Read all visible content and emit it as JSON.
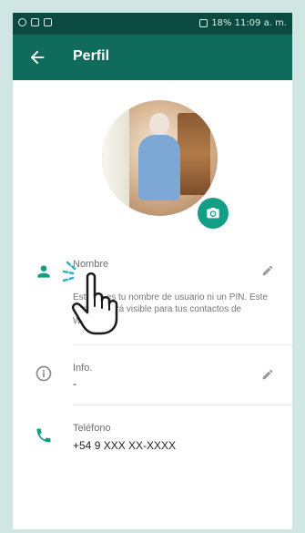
{
  "statusbar": {
    "right_text": "18% 11:09 a. m."
  },
  "appbar": {
    "title": "Perfil"
  },
  "profile": {
    "name": {
      "label": "Nombre",
      "hint": "Este no es tu nombre de usuario ni un PIN. Este nombre será visible para tus contactos de WhatsApp."
    },
    "info": {
      "label": "Info.",
      "value": "-"
    },
    "phone": {
      "label": "Teléfono",
      "value": "+54 9 XXX XX-XXXX"
    }
  },
  "icons": {
    "back": "arrow-left-icon",
    "camera": "camera-icon",
    "person": "person-icon",
    "info": "info-icon",
    "phone": "phone-icon",
    "edit": "pencil-icon",
    "pointer": "hand-pointer-icon"
  },
  "colors": {
    "statusbar": "#0a4a40",
    "appbar": "#0f6b5b",
    "accent": "#139e86",
    "background": "#cfe6e3"
  }
}
